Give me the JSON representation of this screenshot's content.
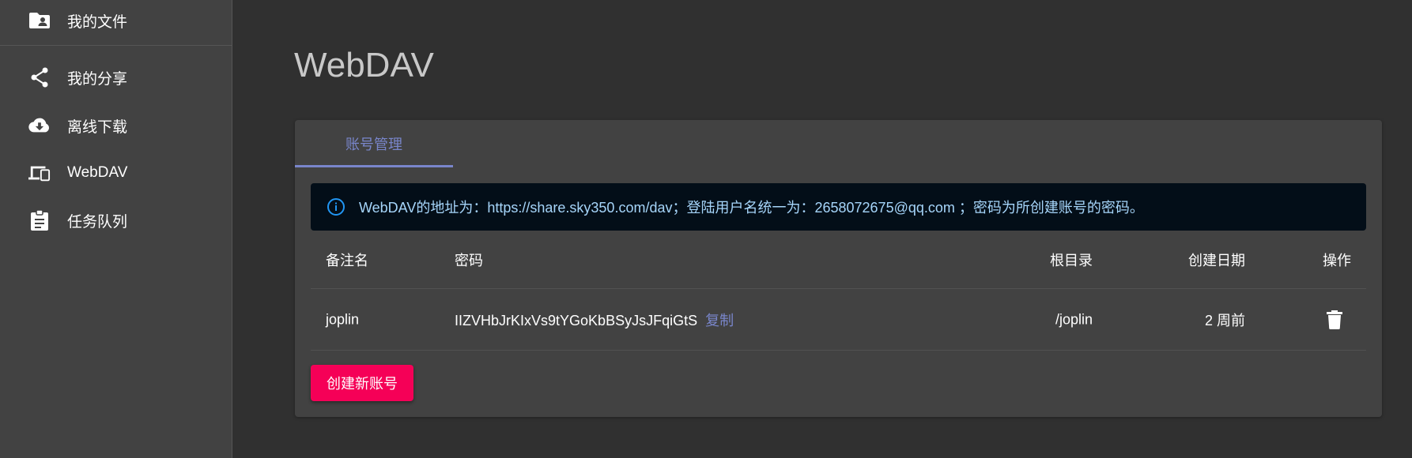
{
  "sidebar": {
    "items": [
      {
        "label": "我的文件",
        "icon": "folder-user-icon"
      },
      {
        "label": "我的分享",
        "icon": "share-icon"
      },
      {
        "label": "离线下载",
        "icon": "cloud-download-icon"
      },
      {
        "label": "WebDAV",
        "icon": "devices-icon"
      },
      {
        "label": "任务队列",
        "icon": "clipboard-icon"
      }
    ]
  },
  "page": {
    "title": "WebDAV"
  },
  "tabs": [
    {
      "label": "账号管理",
      "active": true
    }
  ],
  "alert": {
    "icon": "info-icon",
    "text": "WebDAV的地址为：https://share.sky350.com/dav；登陆用户名统一为：2658072675@qq.com ；密码为所创建账号的密码。"
  },
  "table": {
    "headers": {
      "name": "备注名",
      "password": "密码",
      "root": "根目录",
      "created": "创建日期",
      "actions": "操作"
    },
    "rows": [
      {
        "name": "joplin",
        "password": "IIZVHbJrKIxVs9tYGoKbBSyJsJFqiGtS",
        "copy_label": "复制",
        "root": "/joplin",
        "created": "2 周前",
        "action_icon": "trash-icon"
      }
    ]
  },
  "buttons": {
    "create": "创建新账号"
  },
  "colors": {
    "accent": "#7986cb",
    "primary_button": "#f50057",
    "alert_bg": "#030e18",
    "alert_text": "#a6d5fa"
  }
}
